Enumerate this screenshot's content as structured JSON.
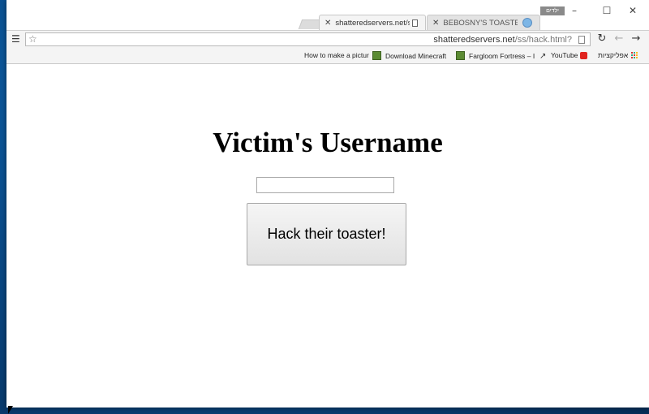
{
  "browser": {
    "tabs": [
      {
        "title": "shatteredservers.net/ss/h...",
        "active": true
      },
      {
        "title": "BEBOSNY'S TOASTER HA...",
        "active": false
      }
    ],
    "user_badge": "ילדים",
    "window_controls": {
      "minimize": "–",
      "maximize": "☐",
      "close": "✕"
    },
    "address": {
      "domain": "shatteredservers.net",
      "path": "/ss/hack.html?"
    },
    "nav": {
      "reload": "↻",
      "back": "←",
      "forward": "→"
    },
    "menu_icon": "☰",
    "star_icon": "☆"
  },
  "bookmarks": {
    "items": [
      {
        "label": "How to make a pictur",
        "icon": "none"
      },
      {
        "label": "Download Minecraft",
        "icon": "minecraft-block-icon"
      },
      {
        "label": "Fargloom Fortress – I",
        "icon": "minecraft-block-icon"
      },
      {
        "label": "YouTube",
        "icon": "youtube-icon"
      },
      {
        "label": "אפליקציות",
        "icon": "apps-grid-icon"
      }
    ]
  },
  "page": {
    "heading": "Victim's Username",
    "input_value": "",
    "button_label": "Hack their toaster!"
  },
  "colors": {
    "desktop": "#0a4a87",
    "button_top": "#f5f5f5",
    "button_bottom": "#e2e2e2"
  }
}
